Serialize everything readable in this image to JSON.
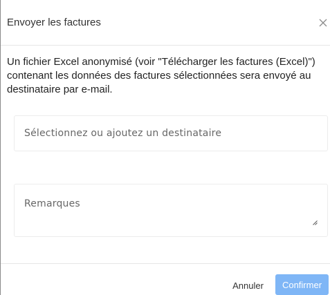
{
  "dialog": {
    "title": "Envoyer les factures",
    "description": "Un fichier Excel anonymisé (voir \"Télécharger les factures (Excel)\") contenant les données des factures sélectionnées sera envoyé au destinataire par e-mail."
  },
  "recipient": {
    "placeholder": "Sélectionnez ou ajoutez un destinataire",
    "value": ""
  },
  "remarks": {
    "placeholder": "Remarques",
    "value": ""
  },
  "footer": {
    "cancel_label": "Annuler",
    "confirm_label": "Confirmer"
  },
  "colors": {
    "confirm_button": "#7fb6f6",
    "border": "#ececec",
    "text": "#222222"
  },
  "icons": {
    "close": "close-icon",
    "resize": "resize-handle-icon"
  }
}
